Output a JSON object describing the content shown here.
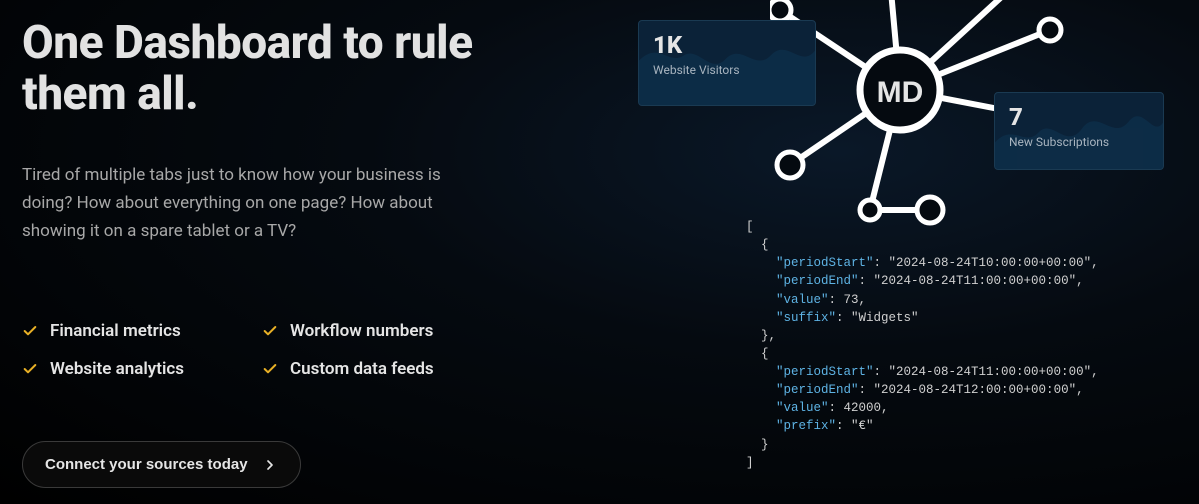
{
  "headline": "One Dashboard to rule them all.",
  "sub": "Tired of multiple tabs just to know how your business is doing? How about everything on one page? How about showing it on a spare tablet or a TV?",
  "features": [
    "Financial metrics",
    "Workflow numbers",
    "Website analytics",
    "Custom data feeds"
  ],
  "cta": "Connect your sources today",
  "logoBadge": "MD",
  "cards": {
    "visitors": {
      "value": "1K",
      "label": "Website Visitors"
    },
    "subs": {
      "value": "7",
      "label": "New Subscriptions"
    }
  },
  "code": {
    "line1": "[",
    "line2": "  {",
    "line3k": "    \"periodStart\"",
    "line3v": ": \"2024-08-24T10:00:00+00:00\",",
    "line4k": "    \"periodEnd\"",
    "line4v": ": \"2024-08-24T11:00:00+00:00\",",
    "line5k": "    \"value\"",
    "line5v": ": 73,",
    "line6k": "    \"suffix\"",
    "line6v": ": \"Widgets\"",
    "line7": "  },",
    "line8": "  {",
    "line9k": "    \"periodStart\"",
    "line9v": ": \"2024-08-24T11:00:00+00:00\",",
    "line10k": "    \"periodEnd\"",
    "line10v": ": \"2024-08-24T12:00:00+00:00\",",
    "line11k": "    \"value\"",
    "line11v": ": 42000,",
    "line12k": "    \"prefix\"",
    "line12v": ": \"€\"",
    "line13": "  }",
    "line14": "]"
  }
}
